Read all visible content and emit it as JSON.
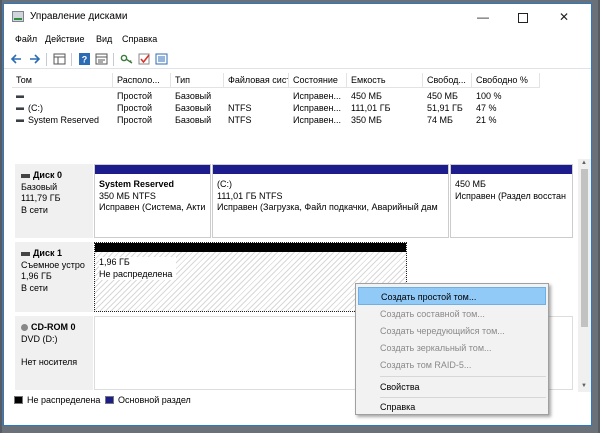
{
  "window": {
    "title": "Управление дисками",
    "controls": {
      "minimize": "—",
      "maximize": "",
      "close": "✕"
    }
  },
  "menu": [
    "Файл",
    "Действие",
    "Вид",
    "Справка"
  ],
  "toolbar": {
    "icons": [
      "back-icon",
      "forward-icon",
      "grid-view-icon",
      "help-icon",
      "properties-icon",
      "key-icon",
      "checkmark-icon",
      "list-view-icon"
    ]
  },
  "volume_table": {
    "columns": [
      "Том",
      "Располо...",
      "Тип",
      "Файловая систе...",
      "Состояние",
      "Емкость",
      "Свобод...",
      "Свободно %"
    ],
    "rows": [
      [
        "",
        "Простой",
        "Базовый",
        "",
        "Исправен...",
        "450 МБ",
        "450 МБ",
        "100 %"
      ],
      [
        "(C:)",
        "Простой",
        "Базовый",
        "NTFS",
        "Исправен...",
        "111,01 ГБ",
        "51,91 ГБ",
        "47 %"
      ],
      [
        "System Reserved",
        "Простой",
        "Базовый",
        "NTFS",
        "Исправен...",
        "350 МБ",
        "74 МБ",
        "21 %"
      ]
    ]
  },
  "disks": [
    {
      "name": "Диск 0",
      "lines": [
        "Базовый",
        "111,79 ГБ",
        "В сети"
      ],
      "partitions": [
        {
          "lines": [
            "System Reserved",
            "350 МБ NTFS",
            "Исправен (Система, Акти"
          ]
        },
        {
          "lines": [
            "(C:)",
            "111,01 ГБ NTFS",
            "Исправен (Загрузка, Файл подкачки, Аварийный дам"
          ]
        },
        {
          "lines": [
            "",
            "450 МБ",
            "Исправен (Раздел восстан"
          ]
        }
      ]
    },
    {
      "name": "Диск 1",
      "lines": [
        "Съемное устро",
        "1,96 ГБ",
        "В сети"
      ],
      "partitions": [
        {
          "lines": [
            "1,96 ГБ",
            "Не распределена"
          ]
        }
      ]
    },
    {
      "name": "CD-ROM 0",
      "lines": [
        "DVD (D:)",
        "",
        "Нет носителя"
      ]
    }
  ],
  "legend": [
    {
      "label": "Не распределена",
      "color": "#000000"
    },
    {
      "label": "Основной раздел",
      "color": "#1c1c8c"
    }
  ],
  "context_menu": {
    "items": [
      {
        "label": "Создать простой том...",
        "enabled": true,
        "highlighted": true
      },
      {
        "label": "Создать составной том...",
        "enabled": false
      },
      {
        "label": "Создать чередующийся том...",
        "enabled": false
      },
      {
        "label": "Создать зеркальный том...",
        "enabled": false
      },
      {
        "label": "Создать том RAID-5...",
        "enabled": false
      },
      {
        "label": "Свойства",
        "enabled": true
      },
      {
        "label": "Справка",
        "enabled": true
      }
    ]
  },
  "colors": {
    "primary_partition": "#1c1c8c",
    "unallocated": "#000000",
    "highlight": "#91c9f7",
    "window_border": "#2b78c5"
  }
}
